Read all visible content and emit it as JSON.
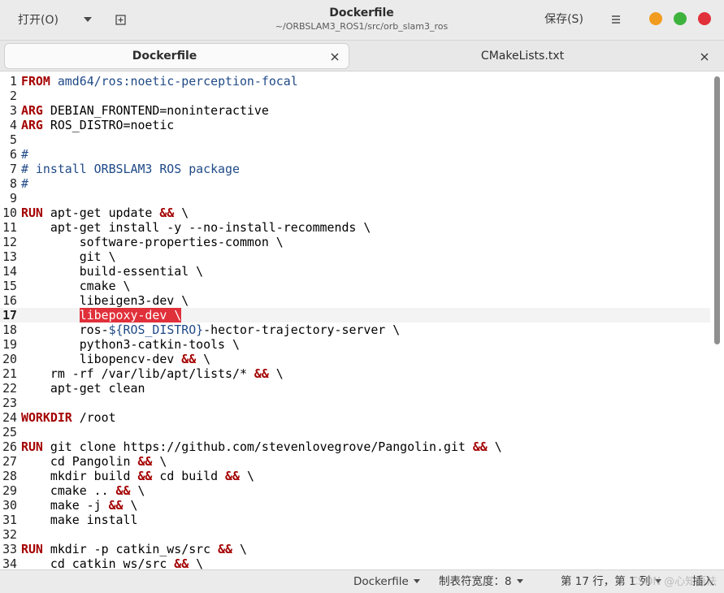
{
  "header": {
    "open_label": "打开(O)",
    "title": "Dockerfile",
    "subtitle": "~/ORBSLAM3_ROS1/src/orb_slam3_ros",
    "save_label": "保存(S)"
  },
  "tabs": [
    {
      "label": "Dockerfile",
      "active": true
    },
    {
      "label": "CMakeLists.txt",
      "active": false
    }
  ],
  "editor": {
    "current_line": 17,
    "lines": [
      {
        "n": "1",
        "segs": [
          {
            "t": "FROM",
            "c": "kw"
          },
          {
            "t": " "
          },
          {
            "t": "amd64/ros:noetic-perception-focal",
            "c": "str"
          }
        ]
      },
      {
        "n": "2",
        "segs": []
      },
      {
        "n": "3",
        "segs": [
          {
            "t": "ARG",
            "c": "kw"
          },
          {
            "t": " DEBIAN_FRONTEND=noninteractive"
          }
        ]
      },
      {
        "n": "4",
        "segs": [
          {
            "t": "ARG",
            "c": "kw"
          },
          {
            "t": " ROS_DISTRO=noetic"
          }
        ]
      },
      {
        "n": "5",
        "segs": []
      },
      {
        "n": "6",
        "segs": [
          {
            "t": "#",
            "c": "cm"
          }
        ]
      },
      {
        "n": "7",
        "segs": [
          {
            "t": "# install ORBSLAM3 ROS package",
            "c": "cm"
          }
        ]
      },
      {
        "n": "8",
        "segs": [
          {
            "t": "#",
            "c": "cm"
          }
        ]
      },
      {
        "n": "9",
        "segs": []
      },
      {
        "n": "10",
        "segs": [
          {
            "t": "RUN",
            "c": "kw"
          },
          {
            "t": " apt-get update "
          },
          {
            "t": "&&",
            "c": "op"
          },
          {
            "t": " \\"
          }
        ]
      },
      {
        "n": "11",
        "segs": [
          {
            "t": "    apt-get install -y --no-install-recommends \\"
          }
        ]
      },
      {
        "n": "12",
        "segs": [
          {
            "t": "        software-properties-common \\"
          }
        ]
      },
      {
        "n": "13",
        "segs": [
          {
            "t": "        git \\"
          }
        ]
      },
      {
        "n": "14",
        "segs": [
          {
            "t": "        build-essential \\"
          }
        ]
      },
      {
        "n": "15",
        "segs": [
          {
            "t": "        cmake \\"
          }
        ]
      },
      {
        "n": "16",
        "segs": [
          {
            "t": "        libeigen3-dev \\"
          }
        ]
      },
      {
        "n": "17",
        "segs": [
          {
            "t": "        "
          },
          {
            "t": "libepoxy-dev \\",
            "c": "hl"
          }
        ]
      },
      {
        "n": "18",
        "segs": [
          {
            "t": "        ros-"
          },
          {
            "t": "${ROS_DISTRO}",
            "c": "var"
          },
          {
            "t": "-hector-trajectory-server \\"
          }
        ]
      },
      {
        "n": "19",
        "segs": [
          {
            "t": "        python3-catkin-tools \\"
          }
        ]
      },
      {
        "n": "20",
        "segs": [
          {
            "t": "        libopencv-dev "
          },
          {
            "t": "&&",
            "c": "op"
          },
          {
            "t": " \\"
          }
        ]
      },
      {
        "n": "21",
        "segs": [
          {
            "t": "    rm -rf /var/lib/apt/lists/* "
          },
          {
            "t": "&&",
            "c": "op"
          },
          {
            "t": " \\"
          }
        ]
      },
      {
        "n": "22",
        "segs": [
          {
            "t": "    apt-get clean"
          }
        ]
      },
      {
        "n": "23",
        "segs": []
      },
      {
        "n": "24",
        "segs": [
          {
            "t": "WORKDIR",
            "c": "kw"
          },
          {
            "t": " /root"
          }
        ]
      },
      {
        "n": "25",
        "segs": []
      },
      {
        "n": "26",
        "segs": [
          {
            "t": "RUN",
            "c": "kw"
          },
          {
            "t": " git clone https://github.com/stevenlovegrove/Pangolin.git "
          },
          {
            "t": "&&",
            "c": "op"
          },
          {
            "t": " \\"
          }
        ]
      },
      {
        "n": "27",
        "segs": [
          {
            "t": "    cd Pangolin "
          },
          {
            "t": "&&",
            "c": "op"
          },
          {
            "t": " \\"
          }
        ]
      },
      {
        "n": "28",
        "segs": [
          {
            "t": "    mkdir build "
          },
          {
            "t": "&&",
            "c": "op"
          },
          {
            "t": " cd build "
          },
          {
            "t": "&&",
            "c": "op"
          },
          {
            "t": " \\"
          }
        ]
      },
      {
        "n": "29",
        "segs": [
          {
            "t": "    cmake .. "
          },
          {
            "t": "&&",
            "c": "op"
          },
          {
            "t": " \\"
          }
        ]
      },
      {
        "n": "30",
        "segs": [
          {
            "t": "    make -j "
          },
          {
            "t": "&&",
            "c": "op"
          },
          {
            "t": " \\"
          }
        ]
      },
      {
        "n": "31",
        "segs": [
          {
            "t": "    make install"
          }
        ]
      },
      {
        "n": "32",
        "segs": []
      },
      {
        "n": "33",
        "segs": [
          {
            "t": "RUN",
            "c": "kw"
          },
          {
            "t": " mkdir -p catkin_ws/src "
          },
          {
            "t": "&&",
            "c": "op"
          },
          {
            "t": " \\"
          }
        ]
      },
      {
        "n": "34",
        "segs": [
          {
            "t": "    cd catkin_ws/src "
          },
          {
            "t": "&&",
            "c": "op"
          },
          {
            "t": " \\"
          }
        ]
      }
    ]
  },
  "statusbar": {
    "language": "Dockerfile",
    "tab_width": "制表符宽度：8",
    "position": "第 17 行，第 1 列",
    "mode": "插入",
    "watermark": "CSDN @心知语法"
  },
  "colors": {
    "keyword": "#a40000",
    "string": "#204a87",
    "highlight": "#e0303a",
    "win_minimize": "#f19c1f",
    "win_maximize": "#3db33d",
    "win_close": "#e0303a"
  }
}
